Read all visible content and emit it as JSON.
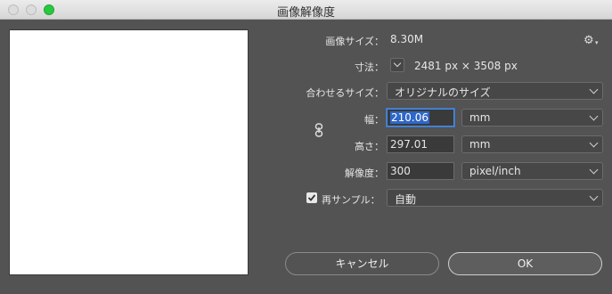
{
  "window": {
    "title": "画像解像度"
  },
  "image_size": {
    "label": "画像サイズ：",
    "value": "8.30M"
  },
  "dimensions": {
    "label": "寸法：",
    "value": "2481 px × 3508 px"
  },
  "fit_to": {
    "label": "合わせるサイズ：",
    "value": "オリジナルのサイズ"
  },
  "width": {
    "label": "幅：",
    "value": "210.06",
    "unit": "mm"
  },
  "height": {
    "label": "高さ：",
    "value": "297.01",
    "unit": "mm"
  },
  "resolution": {
    "label": "解像度：",
    "value": "300",
    "unit": "pixel/inch"
  },
  "resample": {
    "label": "再サンプル：",
    "value": "自動",
    "checked": true
  },
  "buttons": {
    "cancel": "キャンセル",
    "ok": "OK"
  },
  "icons": {
    "settings": "gear-icon",
    "link": "chain-link-icon"
  }
}
